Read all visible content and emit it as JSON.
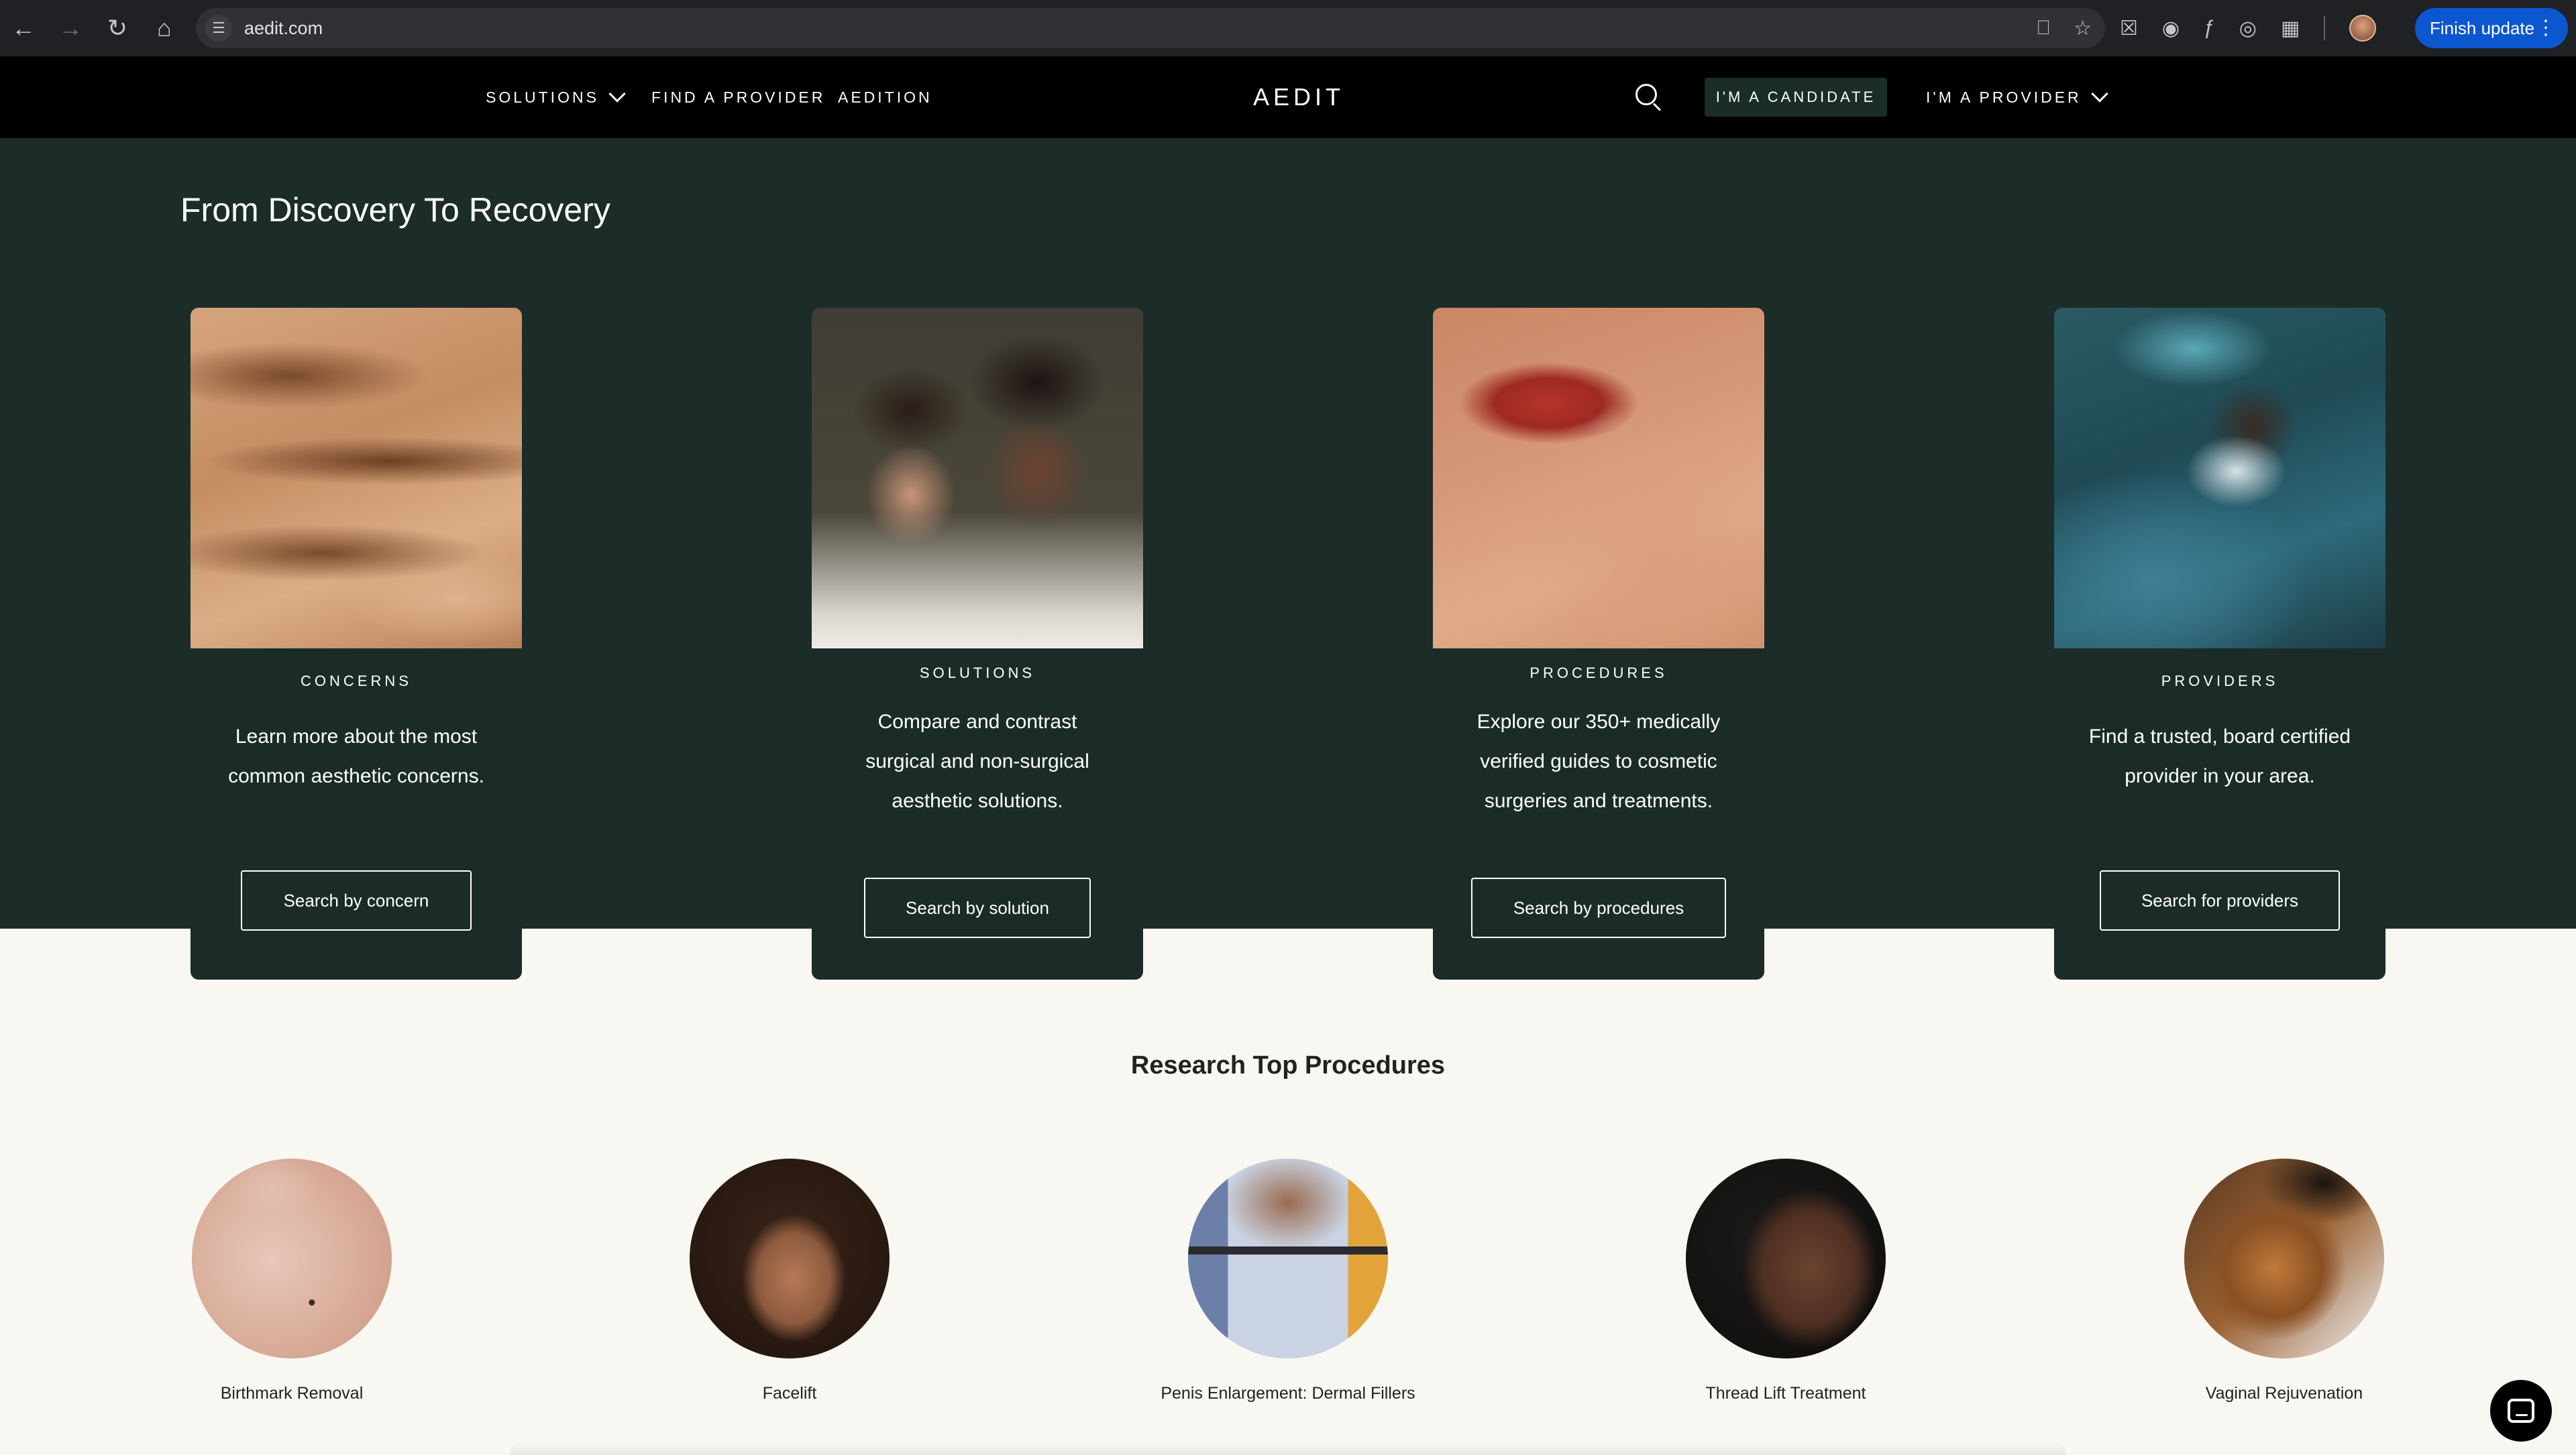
{
  "browser": {
    "url": "aedit.com",
    "update_label": "Finish update"
  },
  "header": {
    "nav": [
      {
        "label": "SOLUTIONS"
      },
      {
        "label": "FIND A PROVIDER"
      },
      {
        "label": "AEDITION"
      }
    ],
    "logo": "AEDIT",
    "candidate_label": "I'M A CANDIDATE",
    "provider_label": "I'M A PROVIDER"
  },
  "hero": {
    "title": "From Discovery To Recovery",
    "cards": [
      {
        "label": "CONCERNS",
        "desc_lines": [
          "Learn more about the most",
          "common aesthetic concerns."
        ],
        "button": "Search by concern"
      },
      {
        "label": "SOLUTIONS",
        "desc_lines": [
          "Compare and contrast",
          "surgical and non-surgical",
          "aesthetic solutions."
        ],
        "button": "Search by solution"
      },
      {
        "label": "PROCEDURES",
        "desc_lines": [
          "Explore our 350+ medically",
          "verified guides to cosmetic",
          "surgeries and treatments."
        ],
        "button": "Search by procedures"
      },
      {
        "label": "PROVIDERS",
        "desc_lines": [
          "Find a trusted, board certified",
          "provider in your area."
        ],
        "button": "Search for providers"
      }
    ]
  },
  "research": {
    "title": "Research Top Procedures",
    "procedures": [
      {
        "name": "Birthmark Removal"
      },
      {
        "name": "Facelift"
      },
      {
        "name": "Penis Enlargement: Dermal Fillers"
      },
      {
        "name": "Thread Lift Treatment"
      },
      {
        "name": "Vaginal Rejuvenation"
      }
    ]
  },
  "colors": {
    "hero_bg": "#1c2d29",
    "card_bg": "#1b2c28",
    "page_bg": "#f9f7f1",
    "header_bg": "#000000",
    "candidate_btn_bg": "#1b2d28",
    "update_btn_bg": "#0b57d0"
  }
}
